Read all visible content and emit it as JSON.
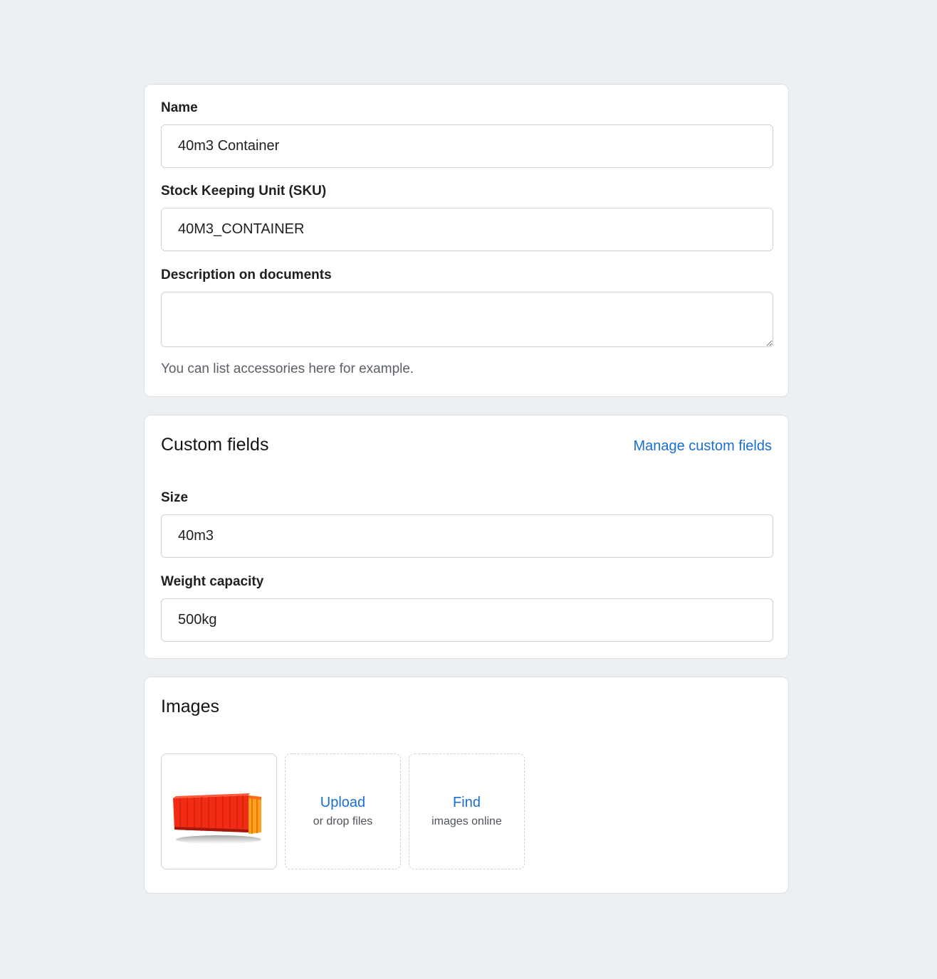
{
  "general": {
    "name_label": "Name",
    "name_value": "40m3 Container",
    "sku_label": "Stock Keeping Unit (SKU)",
    "sku_value": "40M3_CONTAINER",
    "description_label": "Description on documents",
    "description_value": "",
    "description_help": "You can list accessories here for example."
  },
  "custom_fields": {
    "title": "Custom fields",
    "manage_link": "Manage custom fields",
    "size_label": "Size",
    "size_value": "40m3",
    "weight_label": "Weight capacity",
    "weight_value": "500kg"
  },
  "images": {
    "title": "Images",
    "upload_main": "Upload",
    "upload_sub": "or drop files",
    "find_main": "Find",
    "find_sub": "images online",
    "thumbnail_icon": "container-image"
  },
  "colors": {
    "background": "#edf0f2",
    "card": "#ffffff",
    "link": "#1a6fd1",
    "container_red": "#f12b14",
    "container_orange": "#ffa11a"
  }
}
